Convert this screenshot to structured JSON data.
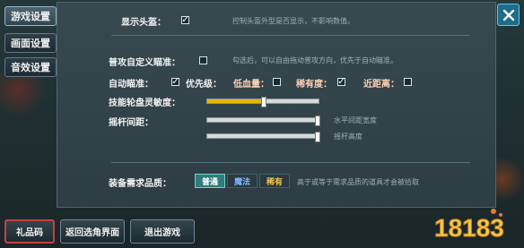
{
  "tabs": [
    "游戏设置",
    "画面设置",
    "音效设置"
  ],
  "settings": {
    "show_head": {
      "label": "显示头盔：",
      "checked": true,
      "hint": "控制头盔外型是否显示，不影响数值。"
    },
    "custom_aim": {
      "label": "普攻自定义瞄准：",
      "checked": false,
      "hint": "勾选后，可以自由拖动普攻方向，优先于自动瞄准。"
    },
    "auto_aim": {
      "label": "自动瞄准：",
      "checked": true
    },
    "priority": {
      "label": "优先级：",
      "checked": false
    },
    "low_hp": {
      "label": "低血量：",
      "checked": false
    },
    "rarity": {
      "label": "稀有度：",
      "checked": true
    },
    "nearest": {
      "label": "近距离：",
      "checked": false
    },
    "skill_sensitivity": {
      "label": "技能轮盘灵敏度：",
      "value": 0.5
    },
    "joystick_spacing": {
      "label": "摇杆间距：",
      "horizontal": {
        "hint": "水平间距宽度",
        "value": 1.0
      },
      "vertical": {
        "hint": "摇杆高度",
        "value": 1.0
      }
    },
    "equip_quality": {
      "label": "装备需求品质：",
      "options": [
        "普通",
        "魔法",
        "稀有"
      ],
      "selected": "普通",
      "hint": "高于或等于需求品质的道具才会被拾取"
    }
  },
  "bottom_buttons": {
    "gift_code": "礼品码",
    "back_to_select": "返回选角界面",
    "exit_game": "退出游戏"
  },
  "watermark": {
    "text": "18183"
  },
  "colors": {
    "accent_yellow": "#e7b600",
    "selected_tab_border": "#c6413f",
    "quality_common": "#2f7c7a",
    "quality_magic": "#7fb6ff",
    "quality_rare": "#f2c94c"
  }
}
